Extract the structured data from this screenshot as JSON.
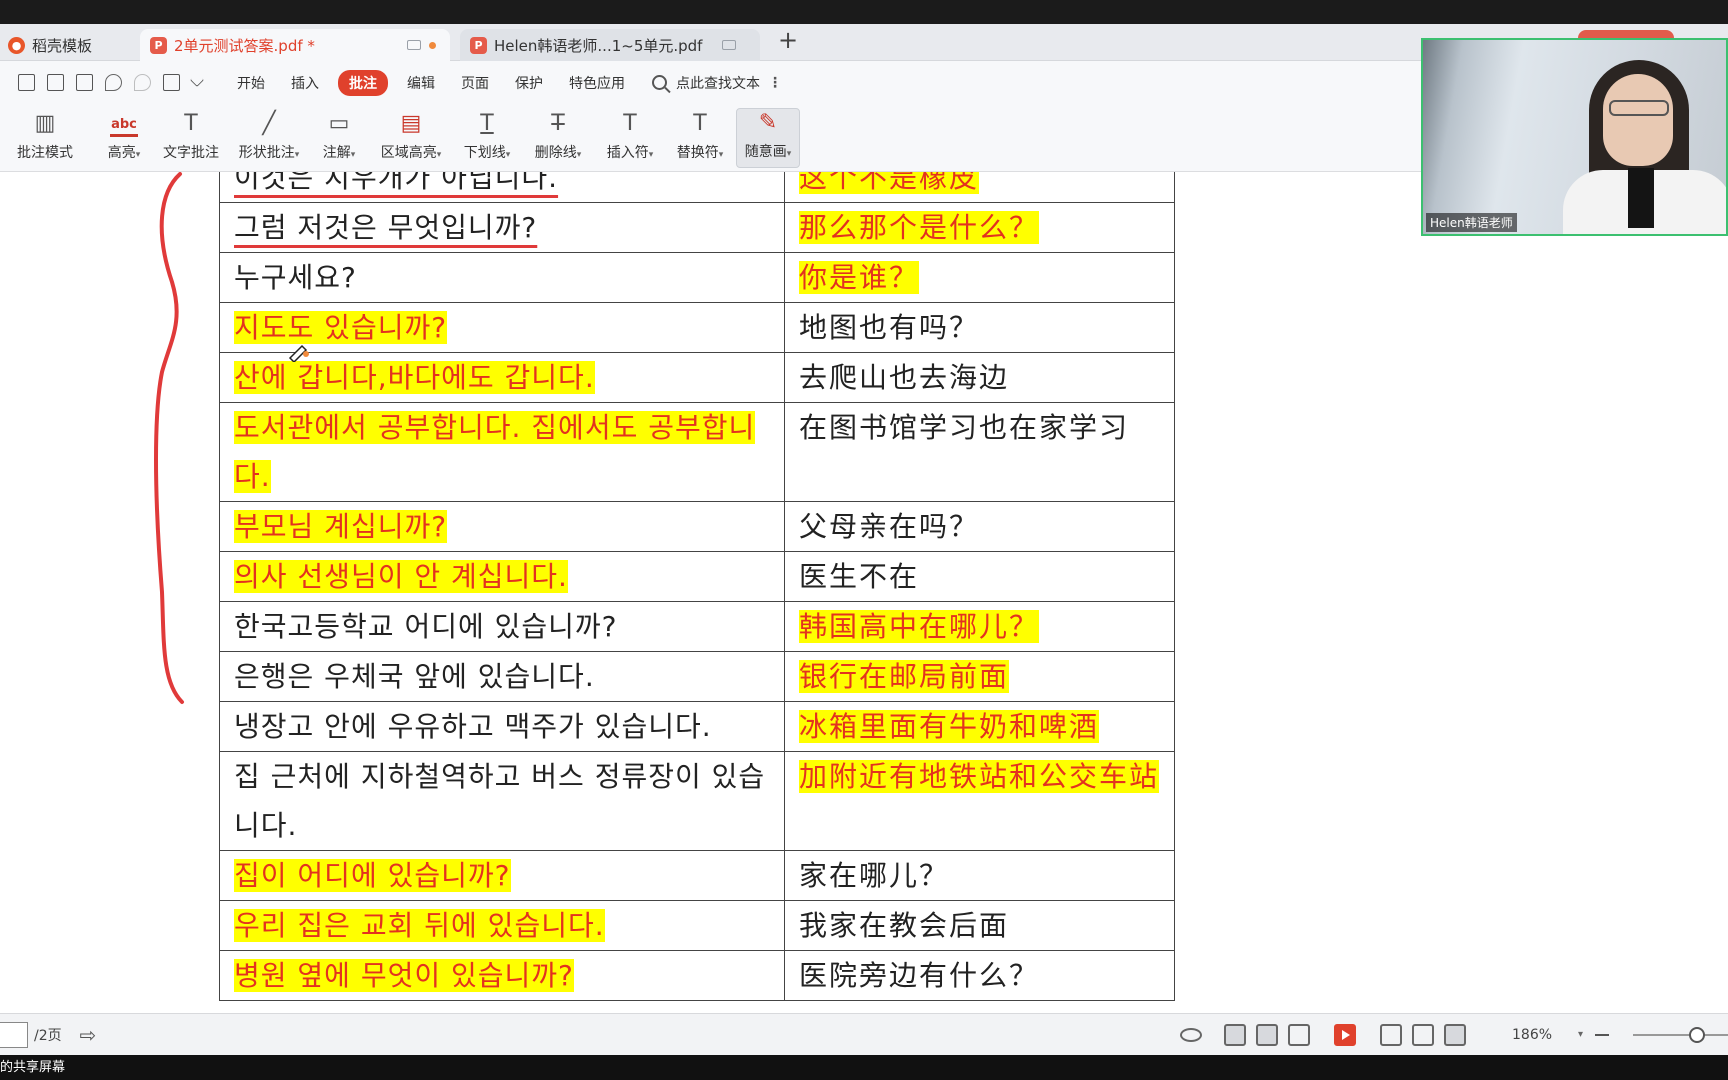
{
  "tabs": [
    {
      "label": "稻壳模板",
      "icon": "wps-logo-icon"
    },
    {
      "label": "2单元测试答案.pdf *",
      "icon": "pdf-icon",
      "active": true
    },
    {
      "label": "Helen韩语老师...1~5单元.pdf",
      "icon": "pdf-icon"
    }
  ],
  "menu": {
    "items": [
      "开始",
      "插入",
      "批注",
      "编辑",
      "页面",
      "保护",
      "特色应用"
    ],
    "active": "批注",
    "search_placeholder": "点此查找文本"
  },
  "toolbar": {
    "mode": "批注模式",
    "highlight": "高亮",
    "text_comment": "文字批注",
    "shape_comment": "形状批注",
    "note": "注解",
    "area_highlight": "区域高亮",
    "underline": "下划线",
    "strikethrough": "删除线",
    "insert_mark": "插入符",
    "replace_mark": "替换符",
    "freehand": "随意画",
    "abc_glyph": "abc"
  },
  "doc": {
    "rows": [
      {
        "ko": "이것은 지우개가 아닙니다.",
        "zh": "这个不是橡皮",
        "ko_hl": false,
        "zh_hl": true
      },
      {
        "ko": "그럼 저것은 무엇입니까?",
        "zh": "那么那个是什么？",
        "ko_hl": false,
        "zh_hl": true
      },
      {
        "ko": " 누구세요?",
        "zh": "你是谁？",
        "ko_hl": false,
        "zh_hl": true
      },
      {
        "ko": "지도도 있습니까?",
        "zh": "地图也有吗？",
        "ko_hl": true,
        "zh_hl": false
      },
      {
        "ko": "산에 갑니다,바다에도 갑니다.",
        "zh": "去爬山也去海边",
        "ko_hl": true,
        "zh_hl": false
      },
      {
        "ko": "도서관에서 공부합니다. 집에서도 공부합니다.",
        "zh": "在图书馆学习也在家学习",
        "ko_hl": true,
        "zh_hl": false
      },
      {
        "ko": "부모님 계십니까?",
        "zh": "父母亲在吗？",
        "ko_hl": true,
        "zh_hl": false
      },
      {
        "ko": "의사 선생님이 안 계십니다.",
        "zh": "医生不在",
        "ko_hl": true,
        "zh_hl": false
      },
      {
        "ko": "한국고등학교 어디에 있습니까?",
        "zh": "韩国高中在哪儿？",
        "ko_hl": false,
        "zh_hl": true
      },
      {
        "ko": "은행은 우체국 앞에 있습니다.",
        "zh": "银行在邮局前面",
        "ko_hl": false,
        "zh_hl": true
      },
      {
        "ko": "냉장고 안에 우유하고 맥주가 있습니다.",
        "zh": "冰箱里面有牛奶和啤酒",
        "ko_hl": false,
        "zh_hl": true
      },
      {
        "ko": "집 근처에 지하철역하고 버스 정류장이 있습니다.",
        "zh": "加附近有地铁站和公交车站",
        "ko_hl": false,
        "zh_hl": true
      },
      {
        "ko": "집이 어디에 있습니까?",
        "zh": "家在哪儿？",
        "ko_hl": true,
        "zh_hl": false
      },
      {
        "ko": "우리 집은 교회 뒤에 있습니다.",
        "zh": "我家在教会后面",
        "ko_hl": true,
        "zh_hl": false
      },
      {
        "ko": "병원 옆에 무엇이 있습니까?",
        "zh": "医院旁边有什么？",
        "ko_hl": true,
        "zh_hl": false
      }
    ]
  },
  "status": {
    "page_input": "",
    "page_total": "/2页",
    "zoom": "186%"
  },
  "webcam": {
    "label": "Helen韩语老师"
  },
  "bottom_caption": "的共享屏幕",
  "colors": {
    "accent": "#e0412c",
    "highlight": "#ffff00",
    "highlight_text": "#e3321f",
    "ink": "#e03a3a"
  }
}
